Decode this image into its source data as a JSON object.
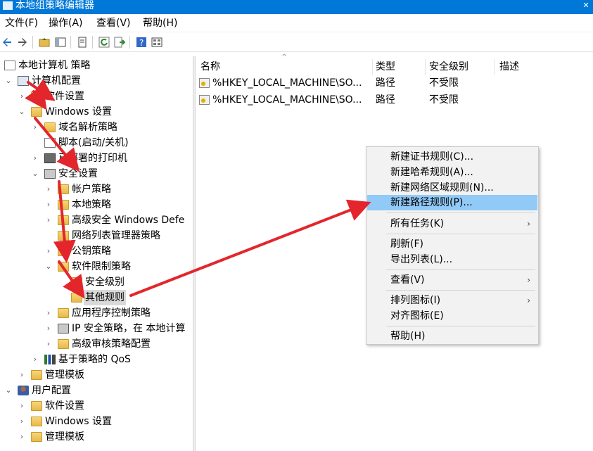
{
  "window": {
    "title": "本地组策略编辑器"
  },
  "menu": [
    "文件(F)",
    "操作(A)",
    "查看(V)",
    "帮助(H)"
  ],
  "toolbar_icons": [
    "back-arrow-icon",
    "forward-arrow-icon",
    "up-folder-icon",
    "show-hide-tree-icon",
    "properties-icon",
    "refresh-icon",
    "export-list-icon",
    "help-icon",
    "view-icon"
  ],
  "tree": [
    {
      "label": "本地计算机 策略",
      "icon": "policy-doc-icon"
    },
    {
      "label": "计算机配置",
      "icon": "computer-icon"
    },
    {
      "label": "软件设置",
      "icon": "folder-icon"
    },
    {
      "label": "Windows 设置",
      "icon": "folder-icon"
    },
    {
      "label": "域名解析策略",
      "icon": "folder-icon"
    },
    {
      "label": "脚本(启动/关机)",
      "icon": "script-icon"
    },
    {
      "label": "已部署的打印机",
      "icon": "printer-icon"
    },
    {
      "label": "安全设置",
      "icon": "security-icon"
    },
    {
      "label": "帐户策略",
      "icon": "folder-icon"
    },
    {
      "label": "本地策略",
      "icon": "folder-icon"
    },
    {
      "label": "高级安全 Windows Defe",
      "icon": "folder-icon"
    },
    {
      "label": "网络列表管理器策略",
      "icon": "folder-icon"
    },
    {
      "label": "公钥策略",
      "icon": "folder-icon"
    },
    {
      "label": "软件限制策略",
      "icon": "folder-icon"
    },
    {
      "label": "安全级别",
      "icon": "folder-icon"
    },
    {
      "label": "其他规则",
      "icon": "folder-icon"
    },
    {
      "label": "应用程序控制策略",
      "icon": "folder-icon"
    },
    {
      "label": "IP 安全策略，在 本地计算",
      "icon": "ip-security-icon"
    },
    {
      "label": "高级审核策略配置",
      "icon": "folder-icon"
    },
    {
      "label": "基于策略的 QoS",
      "icon": "qos-bars-icon"
    },
    {
      "label": "管理模板",
      "icon": "folder-icon"
    },
    {
      "label": "用户配置",
      "icon": "user-icon"
    },
    {
      "label": "软件设置",
      "icon": "folder-icon"
    },
    {
      "label": "Windows 设置",
      "icon": "folder-icon"
    },
    {
      "label": "管理模板",
      "icon": "folder-icon"
    }
  ],
  "list": {
    "columns": [
      "名称",
      "类型",
      "安全级别",
      "描述"
    ],
    "rows": [
      {
        "name": "%HKEY_LOCAL_MACHINE\\SO...",
        "type": "路径",
        "level": "不受限",
        "desc": ""
      },
      {
        "name": "%HKEY_LOCAL_MACHINE\\SO...",
        "type": "路径",
        "level": "不受限",
        "desc": ""
      }
    ]
  },
  "context_menu": [
    "新建证书规则(C)...",
    "新建哈希规则(A)...",
    "新建网络区域规则(N)...",
    "新建路径规则(P)...",
    "所有任务(K)",
    "刷新(F)",
    "导出列表(L)...",
    "查看(V)",
    "排列图标(I)",
    "对齐图标(E)",
    "帮助(H)"
  ],
  "colors": {
    "titlebar": "#0078d7",
    "highlight": "#91c9f7",
    "arrow": "#e3262c",
    "menu_bg": "#f2f2f2"
  }
}
